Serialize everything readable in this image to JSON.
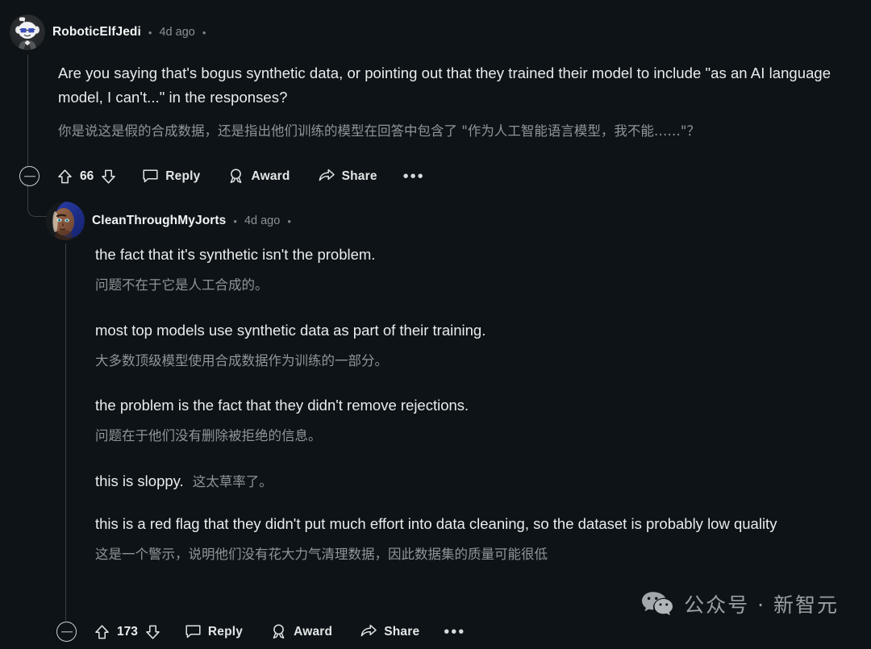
{
  "theme": {
    "background": "#0d1316",
    "body_text": "#e9eced",
    "translation_text": "#8e9699",
    "meta_text": "#8a9296",
    "rail": "#3a4043",
    "icon": "#d6dadc"
  },
  "comments": [
    {
      "id": "top-comment",
      "username": "RoboticElfJedi",
      "separator": "•",
      "timestamp": "4d ago",
      "avatar_name": "snoo-glasses-avatar",
      "paragraphs": [
        {
          "en": "Are you saying that's bogus synthetic data, or pointing out that they trained their model to include \"as an AI language model, I can't...\" in the responses?",
          "zh": "你是说这是假的合成数据，还是指出他们训练的模型在回答中包含了 \"作为人工智能语言模型，我不能……\"？",
          "inline": false
        }
      ],
      "actions": {
        "collapse_label": "collapse",
        "upvote_label": "upvote",
        "vote_count": "66",
        "downvote_label": "downvote",
        "reply_label": "Reply",
        "award_label": "Award",
        "share_label": "Share",
        "more_label": "•••"
      }
    },
    {
      "id": "reply-comment",
      "username": "CleanThroughMyJorts",
      "separator": "•",
      "timestamp": "4d ago",
      "avatar_name": "character-portrait-avatar",
      "paragraphs": [
        {
          "en": "the fact that it's synthetic isn't the problem.",
          "zh": "问题不在于它是人工合成的。",
          "inline": false
        },
        {
          "en": "most top models use synthetic data as part of their training.",
          "zh": "大多数顶级模型使用合成数据作为训练的一部分。",
          "inline": false
        },
        {
          "en": "the problem is the fact that they didn't remove rejections.",
          "zh": "问题在于他们没有删除被拒绝的信息。",
          "inline": false
        },
        {
          "en": "this is sloppy.",
          "zh": "这太草率了。",
          "inline": true
        },
        {
          "en": "this is a red flag that they didn't put much effort into data cleaning, so the dataset is probably low quality",
          "zh": "这是一个警示，说明他们没有花大力气清理数据，因此数据集的质量可能很低",
          "inline": false
        }
      ],
      "actions": {
        "collapse_label": "collapse",
        "upvote_label": "upvote",
        "vote_count": "173",
        "downvote_label": "downvote",
        "reply_label": "Reply",
        "award_label": "Award",
        "share_label": "Share",
        "more_label": "•••"
      }
    }
  ],
  "watermark": {
    "icon_name": "wechat-icon",
    "text": "公众号 · 新智元"
  }
}
